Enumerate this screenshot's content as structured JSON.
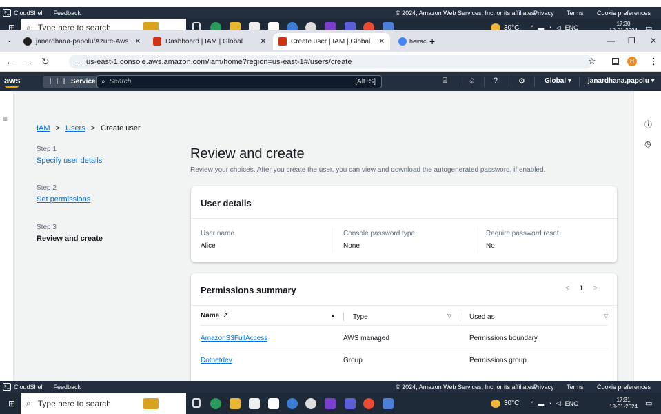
{
  "footer": {
    "cloudshell": "CloudShell",
    "feedback": "Feedback",
    "copyright": "© 2024, Amazon Web Services, Inc. or its affiliates.",
    "privacy": "Privacy",
    "terms": "Terms",
    "cookie": "Cookie preferences"
  },
  "taskbar_top": {
    "search_placeholder": "Type here to search",
    "weather": "30°C",
    "lang": "ENG",
    "time": "17:30",
    "date": "18-01-2024"
  },
  "taskbar_bottom": {
    "search_placeholder": "Type here to search",
    "weather": "30°C",
    "lang": "ENG",
    "time": "17:31",
    "date": "18-01-2024"
  },
  "browser": {
    "tabs": [
      {
        "title": "janardhana-papolu/Azure-Aws"
      },
      {
        "title": "Dashboard | IAM | Global"
      },
      {
        "title": "Create user | IAM | Global"
      },
      {
        "title": "heiracal inheritance efcore don"
      }
    ],
    "url": "us-east-1.console.aws.amazon.com/iam/home?region=us-east-1#/users/create",
    "profile_initial": "H"
  },
  "aws_header": {
    "logo": "aws",
    "services": "Services",
    "search_placeholder": "Search",
    "shortcut": "[Alt+S]",
    "region": "Global ▾",
    "user": "janardhana.papolu ▾"
  },
  "breadcrumb": {
    "iam": "IAM",
    "users": "Users",
    "current": "Create user"
  },
  "steps": [
    {
      "label": "Step 1",
      "name": "Specify user details"
    },
    {
      "label": "Step 2",
      "name": "Set permissions"
    },
    {
      "label": "Step 3",
      "name": "Review and create"
    }
  ],
  "main": {
    "title": "Review and create",
    "subtitle": "Review your choices. After you create the user, you can view and download the autogenerated password, if enabled."
  },
  "user_details": {
    "title": "User details",
    "fields": [
      {
        "label": "User name",
        "value": "Alice"
      },
      {
        "label": "Console password type",
        "value": "None"
      },
      {
        "label": "Require password reset",
        "value": "No"
      }
    ]
  },
  "permissions": {
    "title": "Permissions summary",
    "page": "1",
    "columns": [
      "Name",
      "Type",
      "Used as"
    ],
    "rows": [
      {
        "name": "AmazonS3FullAccess",
        "type": "AWS managed",
        "used_as": "Permissions boundary"
      },
      {
        "name": "Dotnetdev",
        "type": "Group",
        "used_as": "Permissions group"
      }
    ]
  }
}
